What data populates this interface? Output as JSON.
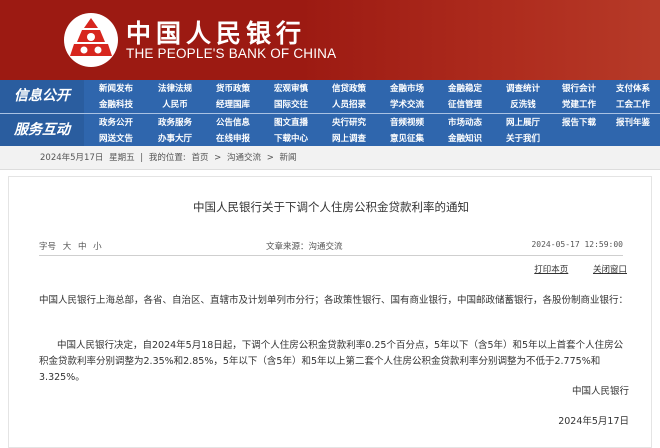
{
  "brand": {
    "name_cn": "中国人民银行",
    "name_en": "THE PEOPLE'S BANK OF CHINA"
  },
  "nav": {
    "section1_label": "信息公开",
    "section2_label": "服务互动",
    "row1": [
      "新闻发布",
      "法律法规",
      "货币政策",
      "宏观审慎",
      "信贷政策",
      "金融市场",
      "金融稳定",
      "调查统计",
      "银行会计",
      "支付体系"
    ],
    "row2": [
      "金融科技",
      "人民币",
      "经理国库",
      "国际交往",
      "人员招录",
      "学术交流",
      "征信管理",
      "反洗钱",
      "党建工作",
      "工会工作"
    ],
    "row3": [
      "政务公开",
      "政务服务",
      "公告信息",
      "图文直播",
      "央行研究",
      "音频视频",
      "市场动态",
      "网上展厅",
      "报告下载",
      "报刊年鉴"
    ],
    "row4": [
      "网送文告",
      "办事大厅",
      "在线申报",
      "下载中心",
      "网上调查",
      "意见征集",
      "金融知识",
      "关于我们"
    ]
  },
  "breadcrumb": {
    "date": "2024年5月17日",
    "weekday": "星期五",
    "sep": "|",
    "prefix": "我的位置:",
    "home": "首页",
    "arrow1": ">",
    "section": "沟通交流",
    "arrow2": ">",
    "current": "新闻"
  },
  "article": {
    "title": "中国人民银行关于下调个人住房公积金贷款利率的通知",
    "font_label": "字号",
    "font_large": "大",
    "font_medium": "中",
    "font_small": "小",
    "source": "文章来源：沟通交流",
    "datetime": "2024-05-17 12:59:00",
    "print_label": "打印本页",
    "close_label": "关闭窗口",
    "para1": "中国人民银行上海总部，各省、自治区、直辖市及计划单列市分行；各政策性银行、国有商业银行，中国邮政储蓄银行，各股份制商业银行：",
    "para2": "中国人民银行决定，自2024年5月18日起，下调个人住房公积金贷款利率0.25个百分点，5年以下（含5年）和5年以上首套个人住房公积金贷款利率分别调整为2.35%和2.85%，5年以下（含5年）和5年以上第二套个人住房公积金贷款利率分别调整为不低于2.775%和3.325%。",
    "signature": "中国人民银行",
    "date": "2024年5月17日"
  },
  "colors": {
    "header_red": "#9c1a12",
    "nav_blue": "#2f66ad",
    "logo_red": "#d7261e"
  },
  "icons": {
    "logo": "pboc-emblem-icon"
  }
}
